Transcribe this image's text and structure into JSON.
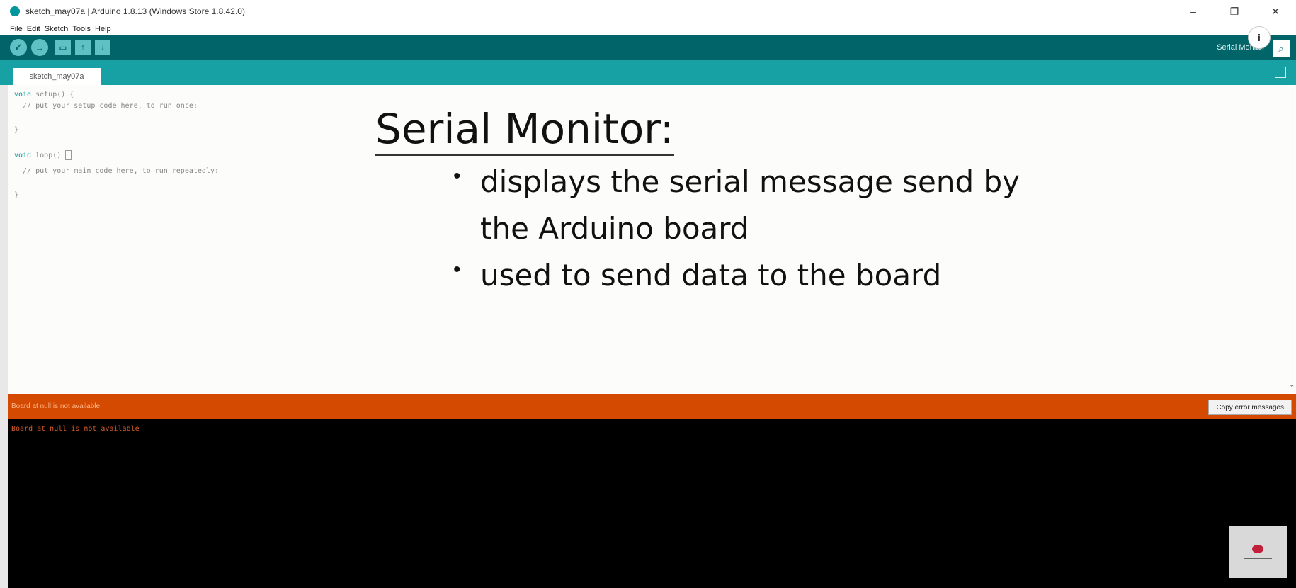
{
  "window": {
    "title": "sketch_may07a | Arduino 1.8.13 (Windows Store 1.8.42.0)",
    "controls": [
      "–",
      "❐",
      "✕"
    ]
  },
  "menu": [
    "File",
    "Edit",
    "Sketch",
    "Tools",
    "Help"
  ],
  "toolbar": {
    "serial_monitor_label": "Serial Monitor",
    "buttons": [
      "verify",
      "upload",
      "new",
      "open",
      "save"
    ]
  },
  "tab": {
    "label": "sketch_may07a"
  },
  "code": {
    "lines": [
      {
        "kw": "void",
        "rest": " setup() {"
      },
      {
        "kw": "",
        "rest": "  // put your setup code here, to run once:"
      },
      {
        "kw": "",
        "rest": "}"
      },
      {
        "kw": "void",
        "rest": " loop() "
      },
      {
        "kw": "",
        "rest": "  // put your main code here, to run repeatedly:"
      },
      {
        "kw": "",
        "rest": "}"
      }
    ]
  },
  "slide": {
    "title": "Serial Monitor:",
    "bullets": [
      "displays the serial message send by",
      "the Arduino board",
      "used to send data to the board"
    ]
  },
  "status": {
    "error_message": "Board at null is not available",
    "copy_button": "Copy error messages"
  },
  "console": {
    "text": "Board at null is not available"
  },
  "colors": {
    "toolbar": "#006468",
    "tabbar": "#17a1a5",
    "error": "#d44a00",
    "console": "#000000"
  }
}
